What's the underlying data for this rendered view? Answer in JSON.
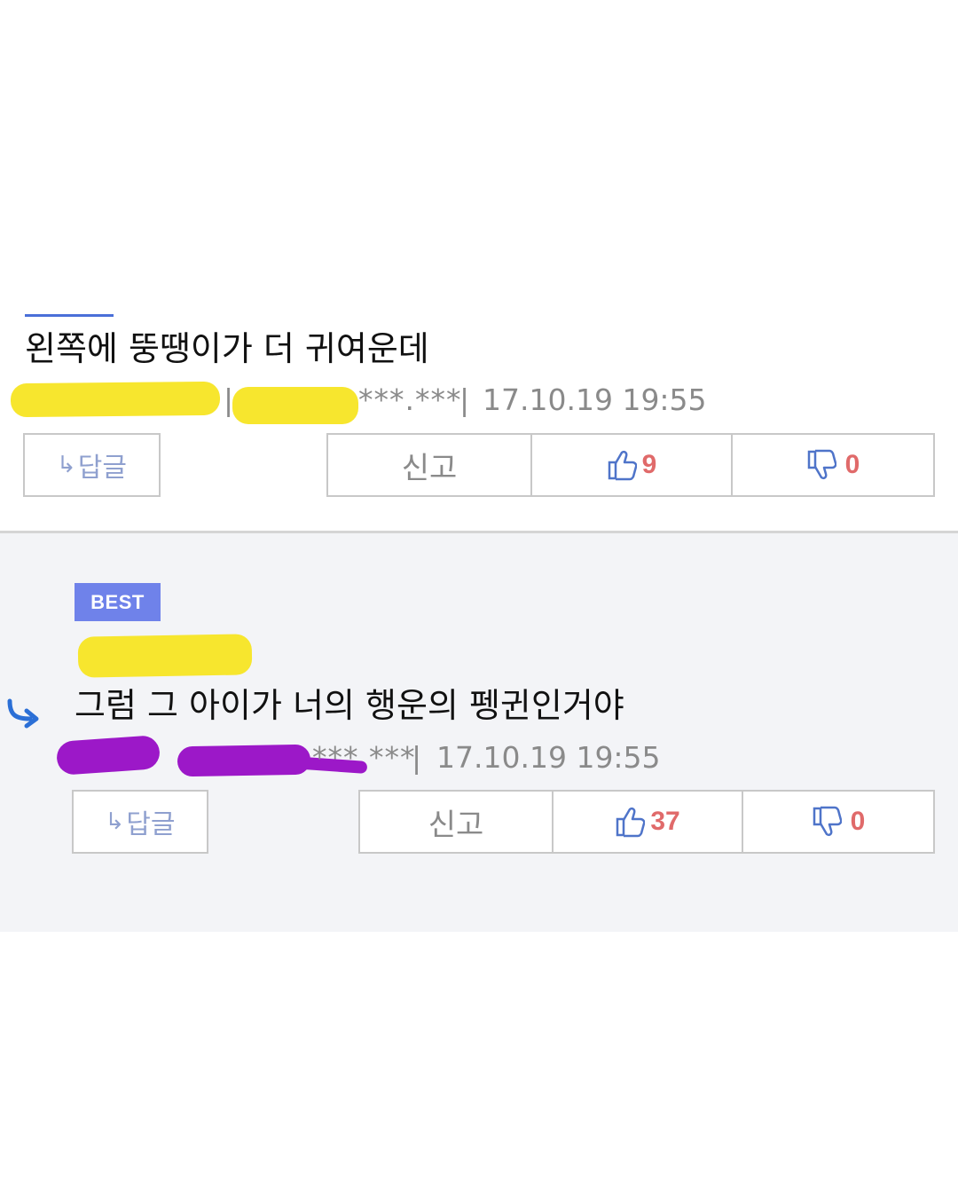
{
  "comments": [
    {
      "text": "왼쪽에 뚱땡이가 더 귀여운데",
      "masked_ip": "***.***",
      "separator": "|",
      "datetime": "17.10.19 19:55",
      "reply_label": "답글",
      "report_label": "신고",
      "likes": "9",
      "dislikes": "0"
    },
    {
      "badge": "BEST",
      "text": "그럼 그 아이가 너의 행운의 펭귄인거야",
      "masked_ip": "*** ***",
      "separator": "|",
      "datetime": "17.10.19 19:55",
      "reply_label": "답글",
      "report_label": "신고",
      "likes": "37",
      "dislikes": "0"
    }
  ],
  "colors": {
    "accent_blue": "#6f82ea",
    "count_red": "#e06a6a",
    "redaction_yellow": "#f7e62e",
    "redaction_purple": "#9c18c8",
    "best_panel_bg": "#f3f4f7"
  },
  "icons": {
    "reply": "reply-arrow-icon",
    "like": "thumbs-up-icon",
    "dislike": "thumbs-down-icon",
    "nested_reply": "curved-reply-arrow-icon"
  }
}
